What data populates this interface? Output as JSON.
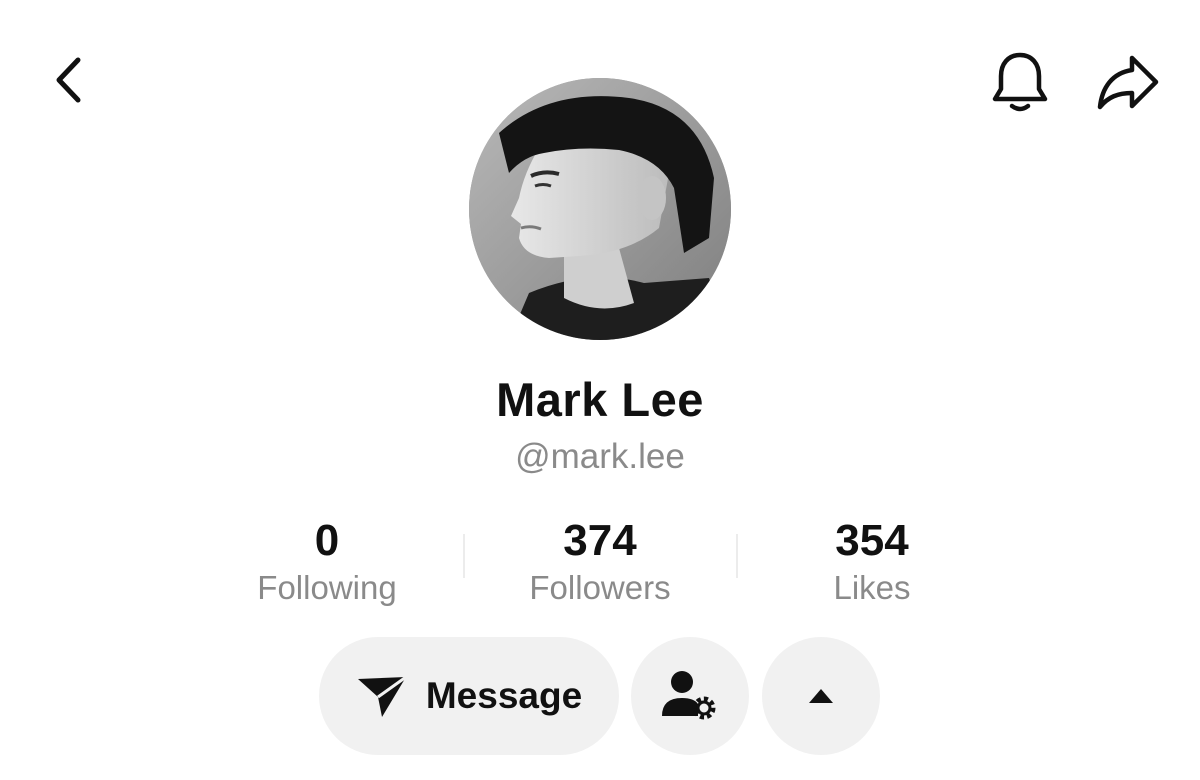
{
  "header": {
    "back_icon": "chevron-left-icon",
    "bell_icon": "bell-icon",
    "share_icon": "share-arrow-icon"
  },
  "profile": {
    "name": "Mark Lee",
    "handle": "@mark.lee",
    "avatar": "grayscale-portrait-photo"
  },
  "stats": [
    {
      "value": "0",
      "label": "Following"
    },
    {
      "value": "374",
      "label": "Followers"
    },
    {
      "value": "354",
      "label": "Likes"
    }
  ],
  "actions": {
    "message_label": "Message",
    "message_icon": "send-icon",
    "profile_settings_icon": "person-gear-icon",
    "expand_icon": "caret-up-icon"
  },
  "colors": {
    "text": "#111111",
    "muted": "#8a8a8a",
    "pill_bg": "#f1f1f1"
  }
}
